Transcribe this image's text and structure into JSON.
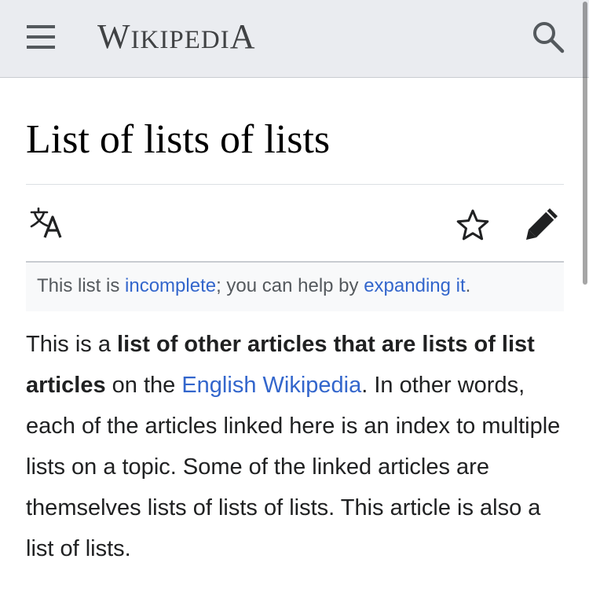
{
  "header": {
    "wordmark_parts": [
      "W",
      "IKIPEDI",
      "A"
    ],
    "icons": {
      "menu": "hamburger-menu-icon",
      "search": "search-icon"
    }
  },
  "article": {
    "title": "List of lists of lists",
    "actions": {
      "language": "language-icon",
      "watch": "star-icon",
      "edit": "pencil-icon"
    },
    "notice": {
      "before": "This list is ",
      "link1": "incomplete",
      "middle": "; you can help by ",
      "link2": "expanding it",
      "after": "."
    },
    "intro": {
      "part1": "This is a ",
      "bold1": "list of other articles that are lists of list articles",
      "part2": " on the ",
      "link": "English Wikipedia",
      "part3": ". In other words, each of the articles linked here is an index to multiple lists on a topic. Some of the linked articles are themselves lists of lists of lists. This article is also a list of lists."
    }
  },
  "colors": {
    "link": "#3366cc",
    "header_bg": "#eaecf0",
    "notice_bg": "#f8f9fa",
    "text": "#202122"
  }
}
